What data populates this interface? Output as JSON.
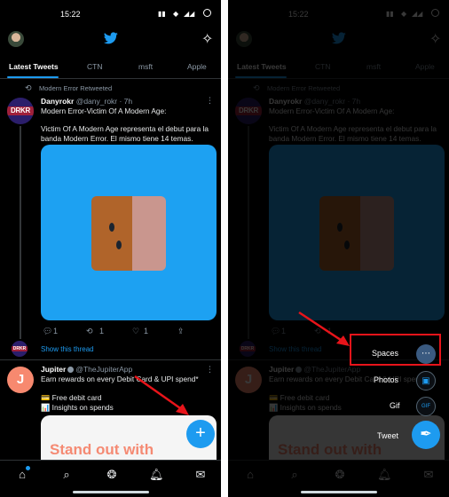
{
  "status_bar": {
    "time": "15:22"
  },
  "tabs": [
    "Latest Tweets",
    "CTN",
    "msft",
    "Apple"
  ],
  "tweet1": {
    "retweet_label": "Modern Error Retweeted",
    "author_name": "Danyrokr",
    "author_handle": "@dany_rokr · 7h",
    "avatar_text": "DRKR",
    "line1": "Modern Error-Victim Of A Modern Age:",
    "line2": "Victim Of A Modern Age representa el debut para la",
    "line3": "banda Modern Error. El mismo tiene 14 temas.",
    "reply_count": "1",
    "retweet_count": "1",
    "like_count": "1",
    "show_thread": "Show this thread"
  },
  "tweet2": {
    "avatar_letter": "J",
    "author_name": "Jupiter",
    "author_handle": "@TheJupiterApp",
    "line1": "Earn rewards on every Debit Card & UPI spend*",
    "line2": "💳 Free debit card",
    "line3": "📊 Insights on spends",
    "ad_headline": "Stand out with",
    "ad_logo": "J"
  },
  "fab_menu": {
    "spaces": "Spaces",
    "photos": "Photos",
    "gif": "Gif",
    "tweet": "Tweet"
  },
  "icons": {
    "fab": "plus-icon",
    "home": "home-icon",
    "search": "search-icon",
    "spaces": "spaces-icon",
    "notifications": "bell-icon",
    "messages": "mail-icon"
  },
  "colors": {
    "accent": "#1d9bf0",
    "annotation": "#e8141a"
  }
}
